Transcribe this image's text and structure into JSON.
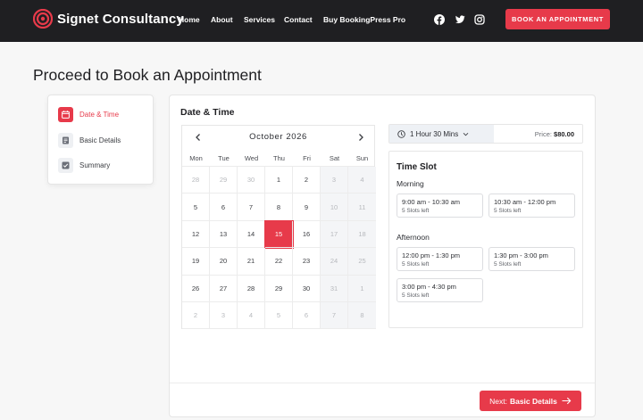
{
  "header": {
    "brand": "Signet Consultancy",
    "nav": [
      "Home",
      "About",
      "Services",
      "Contact",
      "Buy BookingPress Pro"
    ],
    "social_icons": [
      "facebook-icon",
      "twitter-icon",
      "instagram-icon"
    ],
    "cta_label": "BOOK AN APPOINTMENT"
  },
  "page": {
    "title": "Proceed to Book an Appointment"
  },
  "steps": [
    {
      "label": "Date & Time",
      "icon": "calendar-icon",
      "active": true
    },
    {
      "label": "Basic Details",
      "icon": "document-icon",
      "active": false
    },
    {
      "label": "Summary",
      "icon": "checkbox-icon",
      "active": false
    }
  ],
  "main": {
    "section_title": "Date & Time",
    "calendar": {
      "month_label": "October 2026",
      "weekdays": [
        "Mon",
        "Tue",
        "Wed",
        "Thu",
        "Fri",
        "Sat",
        "Sun"
      ],
      "weeks": [
        [
          "28",
          "29",
          "30",
          "1",
          "2",
          "3",
          "4"
        ],
        [
          "5",
          "6",
          "7",
          "8",
          "9",
          "10",
          "11"
        ],
        [
          "12",
          "13",
          "14",
          "15",
          "16",
          "17",
          "18"
        ],
        [
          "19",
          "20",
          "21",
          "22",
          "23",
          "24",
          "25"
        ],
        [
          "26",
          "27",
          "28",
          "29",
          "30",
          "31",
          "1"
        ],
        [
          "2",
          "3",
          "4",
          "5",
          "6",
          "7",
          "8"
        ]
      ],
      "selected_day": "15"
    },
    "duration": {
      "value": "1 Hour 30 Mins",
      "price_label": "Price:",
      "price": "$80.00"
    },
    "time_slot": {
      "title": "Time Slot",
      "morning_label": "Morning",
      "morning": [
        {
          "time": "9:00 am - 10:30 am",
          "left": "5 Slots left"
        },
        {
          "time": "10:30 am - 12:00 pm",
          "left": "5 Slots left"
        }
      ],
      "afternoon_label": "Afternoon",
      "afternoon": [
        {
          "time": "12:00 pm - 1:30 pm",
          "left": "5 Slots left"
        },
        {
          "time": "1:30 pm - 3:00 pm",
          "left": "5 Slots left"
        },
        {
          "time": "3:00 pm - 4:30 pm",
          "left": "5 Slots left"
        }
      ]
    },
    "next_prefix": "Next:",
    "next_label": "Basic Details"
  },
  "colors": {
    "accent": "#e73a4a",
    "header_bg": "#1f1f22"
  }
}
